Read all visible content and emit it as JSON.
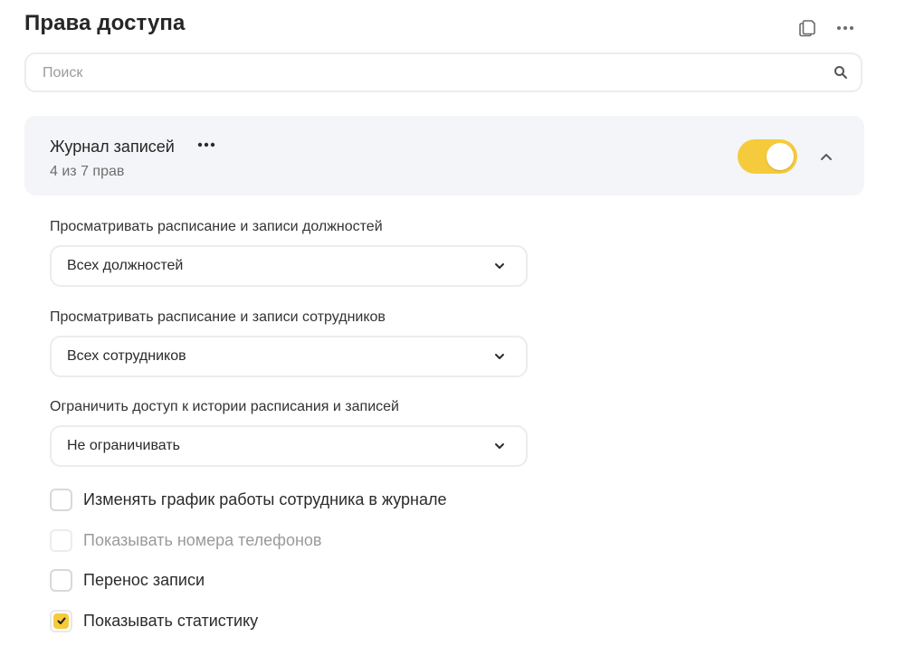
{
  "header": {
    "title": "Права доступа",
    "copy_icon": "copy-icon",
    "more_icon": "more-horizontal-icon"
  },
  "search": {
    "placeholder": "Поиск",
    "value": ""
  },
  "group": {
    "title": "Журнал записей",
    "subtitle": "4 из 7 прав",
    "enabled": true,
    "expanded": true,
    "toggle_color": "#f5cb3c"
  },
  "fields": [
    {
      "label": "Просматривать расписание и записи должностей",
      "value": "Всех должностей"
    },
    {
      "label": "Просматривать расписание и записи сотрудников",
      "value": "Всех сотрудников"
    },
    {
      "label": "Ограничить доступ к истории расписания и записей",
      "value": "Не ограничивать"
    }
  ],
  "permissions": [
    {
      "label": "Изменять график работы сотрудника в журнале",
      "checked": false,
      "disabled": false
    },
    {
      "label": "Показывать номера телефонов",
      "checked": false,
      "disabled": true
    },
    {
      "label": "Перенос записи",
      "checked": false,
      "disabled": false
    },
    {
      "label": "Показывать статистику",
      "checked": true,
      "disabled": false
    }
  ],
  "colors": {
    "accent": "#f5cb3c",
    "card_bg": "#f4f5f8",
    "border": "#ececec"
  }
}
